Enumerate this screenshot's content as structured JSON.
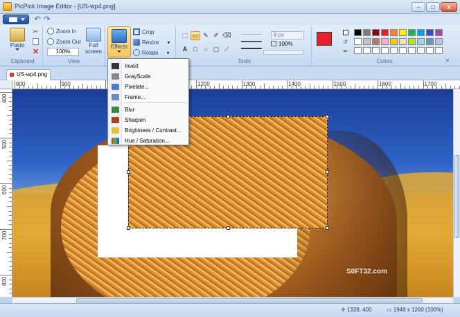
{
  "window": {
    "title": "PicPick Image Editor - [US-wp4.png]"
  },
  "ribbon": {
    "clipboard": {
      "label": "Clipboard",
      "paste": "Paste"
    },
    "view": {
      "label": "View",
      "zoom_in": "Zoom In",
      "zoom_out": "Zoom Out",
      "zoom_value": "100%",
      "full_screen_line1": "Full",
      "full_screen_line2": "screen"
    },
    "image": {
      "effects": "Effects",
      "crop": "Crop",
      "resize": "Resize",
      "rotate": "Rotate"
    },
    "tools": {
      "label": "Tools",
      "line_width": "8 px",
      "opacity": "100%"
    },
    "colors": {
      "label": "Colors",
      "primary": "#e8202b",
      "secondary": "#ffffff",
      "palette_row1": [
        "#000000",
        "#7f7f7f",
        "#880015",
        "#ed1c24",
        "#ff7f27",
        "#fff200",
        "#22b14c",
        "#00a2e8",
        "#3f48cc",
        "#a349a4"
      ],
      "palette_row2": [
        "#ffffff",
        "#c3c3c3",
        "#b97a57",
        "#ffaec9",
        "#ffc90e",
        "#efe4b0",
        "#b5e61d",
        "#99d9ea",
        "#7092be",
        "#c8bfe7"
      ],
      "palette_row3": [
        "#ffffff",
        "#ffffff",
        "#ffffff",
        "#ffffff",
        "#ffffff",
        "#ffffff",
        "#ffffff",
        "#ffffff",
        "#ffffff",
        "#ffffff"
      ]
    }
  },
  "tab": {
    "name": "US-wp4.png"
  },
  "ruler": {
    "top_labels": [
      "800",
      "900",
      "1000",
      "1100",
      "1200",
      "1300",
      "1400",
      "1500",
      "1600",
      "1700"
    ],
    "left_labels": [
      "400",
      "500",
      "600",
      "700",
      "800"
    ]
  },
  "effects_menu": {
    "items": [
      "Invert",
      "GrayScale",
      "Pixelate...",
      "Frame...",
      "Blur",
      "Sharpen",
      "Brightness / Contrast...",
      "Hue / Saturation..."
    ]
  },
  "watermark": "S0FT32.com",
  "status": {
    "cursor": "1328, 400",
    "image_size": "1948 x 1260  (100%)"
  }
}
